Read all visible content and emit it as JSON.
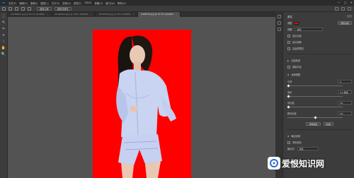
{
  "app": {
    "logo": "Ps"
  },
  "menu": [
    "文件(F)",
    "编辑(E)",
    "图像(I)",
    "图层(L)",
    "文字(Y)",
    "选择(S)",
    "滤镜(T)",
    "3D(D)",
    "视图(V)",
    "窗口(W)",
    "帮助(H)"
  ],
  "window_controls": [
    "—",
    "□",
    "✕"
  ],
  "options": {
    "btn1": "选择主体",
    "btn2": "选择并遮住"
  },
  "tabs": [
    {
      "label": "20180821.jpg @ 66.7% (RGB/8)",
      "active": false
    },
    {
      "label": "20180614.jpg @ 100% (RGB/8)",
      "active": false
    },
    {
      "label": "20180528.jpg @ 50% (RGB/8)",
      "active": false
    },
    {
      "label": "1346578.jpg @ 33.3% (RGB/8)",
      "active": true
    }
  ],
  "tools": [
    "⬚",
    "✎",
    "✂",
    "⌖",
    "♢",
    "✋",
    "🔍"
  ],
  "properties": {
    "title": "属性",
    "row1_label": "调整",
    "row1_btn": "调整边缘",
    "view_label": "视图",
    "mode_value": "叠加",
    "show_edge": "显示边缘",
    "show_original": "显示原稿",
    "high_quality": "高品质预览",
    "edge_detection": "边缘检测",
    "smart_radius": "智能半径",
    "global_refine": "全局调整",
    "sliders": [
      {
        "label": "平滑",
        "value": "0",
        "pos": 0.0
      },
      {
        "label": "羽化",
        "value": "0.0 像素",
        "pos": 0.0
      },
      {
        "label": "对比度",
        "value": "0%",
        "pos": 0.0
      },
      {
        "label": "移动边缘",
        "value": "0%",
        "pos": 0.5
      }
    ],
    "clear_btn": "清除选区",
    "invert_btn": "反相",
    "output": "输出设置",
    "decontaminate": "净化颜色",
    "output_to": "输出到",
    "output_value": "选区"
  },
  "watermark": {
    "text": "爱恨知识网"
  }
}
